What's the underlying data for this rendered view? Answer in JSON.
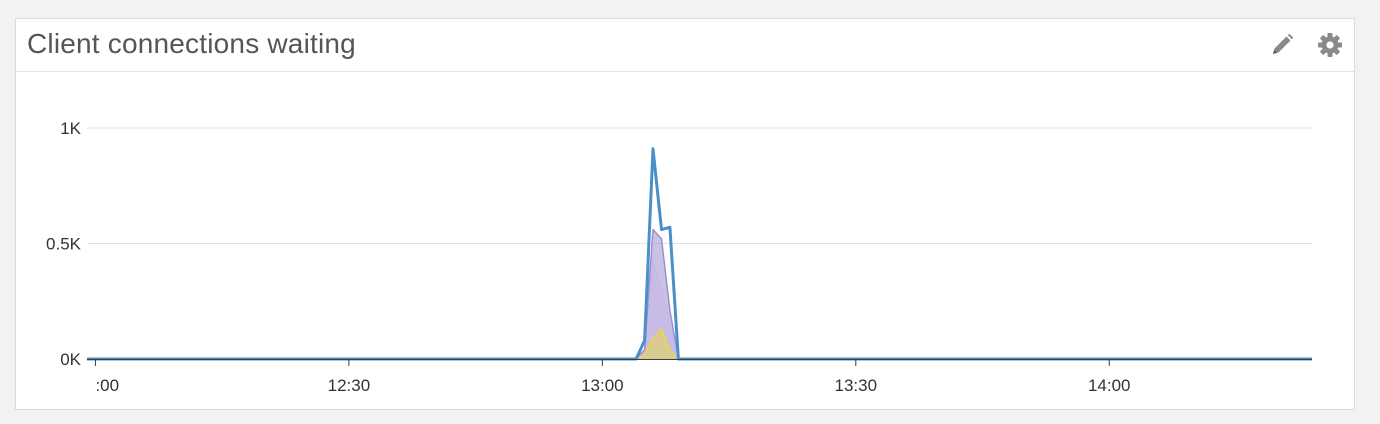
{
  "widget": {
    "title": "Client connections waiting",
    "icons": [
      "pencil-icon",
      "gear-icon"
    ]
  },
  "chart_data": {
    "type": "line",
    "title": "Client connections waiting",
    "xlabel": "",
    "ylabel": "",
    "x_range": [
      "11:59",
      "14:24"
    ],
    "ylim": [
      0,
      1000
    ],
    "y_ticks": [
      {
        "value": 0,
        "label": "0K"
      },
      {
        "value": 500,
        "label": "0.5K"
      },
      {
        "value": 1000,
        "label": "1K"
      }
    ],
    "x_ticks": [
      {
        "time": "12:00",
        "label": ":00"
      },
      {
        "time": "12:30",
        "label": "12:30"
      },
      {
        "time": "13:00",
        "label": "13:00"
      },
      {
        "time": "13:30",
        "label": "13:30"
      },
      {
        "time": "14:00",
        "label": "14:00"
      }
    ],
    "grid": true,
    "series": [
      {
        "color": "#4a90c8",
        "points": [
          [
            "11:59",
            0
          ],
          [
            "13:04",
            0
          ],
          [
            "13:05",
            80
          ],
          [
            "13:06",
            910
          ],
          [
            "13:07",
            560
          ],
          [
            "13:08",
            570
          ],
          [
            "13:09",
            0
          ],
          [
            "14:24",
            0
          ]
        ]
      },
      {
        "color": "#9b8fd0",
        "points": [
          [
            "11:59",
            0
          ],
          [
            "13:04",
            0
          ],
          [
            "13:05",
            40
          ],
          [
            "13:06",
            560
          ],
          [
            "13:07",
            520
          ],
          [
            "13:08",
            210
          ],
          [
            "13:09",
            0
          ],
          [
            "14:24",
            0
          ]
        ]
      },
      {
        "color": "#c9b7e8",
        "points": [
          [
            "11:59",
            0
          ],
          [
            "13:04",
            0
          ],
          [
            "13:05",
            30
          ],
          [
            "13:06",
            420
          ],
          [
            "13:07",
            300
          ],
          [
            "13:08",
            150
          ],
          [
            "13:09",
            0
          ],
          [
            "14:24",
            0
          ]
        ]
      },
      {
        "color": "#e8d84a",
        "points": [
          [
            "11:59",
            0
          ],
          [
            "13:04",
            0
          ],
          [
            "13:05",
            20
          ],
          [
            "13:06",
            90
          ],
          [
            "13:07",
            130
          ],
          [
            "13:08",
            40
          ],
          [
            "13:09",
            0
          ],
          [
            "14:24",
            0
          ]
        ]
      }
    ]
  }
}
